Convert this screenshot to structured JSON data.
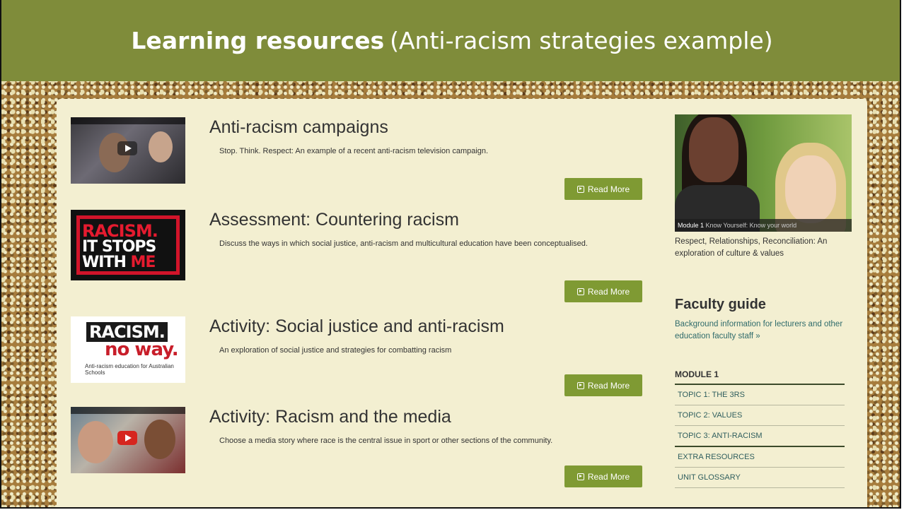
{
  "header": {
    "title_bold": "Learning resources",
    "title_rest": "(Anti-racism strategies example)"
  },
  "articles": [
    {
      "title": "Anti-racism campaigns",
      "description": "Stop. Think. Respect: An example of a recent anti-racism television campaign.",
      "read_more": "Read More",
      "thumbnail": "video-thumbnail"
    },
    {
      "title": "Assessment: Countering racism",
      "description": "Discuss the ways in which social justice, anti-racism and multicultural education have been conceptualised.",
      "read_more": "Read More",
      "thumbnail": {
        "line1": "RACISM.",
        "line2": "IT STOPS",
        "line3a": "WITH ",
        "line3b": "ME"
      }
    },
    {
      "title": "Activity: Social justice and anti-racism",
      "description": "An exploration of social justice and strategies for combatting racism",
      "read_more": "Read More",
      "thumbnail": {
        "line1": "RACISM.",
        "line2": "no way.",
        "line3": "Anti-racism education for Australian Schools"
      }
    },
    {
      "title": "Activity: Racism and the media",
      "description": "Choose a media story where race is the central issue in sport or other sections of the community.",
      "read_more": "Read More",
      "thumbnail": "video-thumbnail"
    }
  ],
  "sidebar": {
    "module_image_caption_a": "Module 1",
    "module_image_caption_b": "Know Yourself: Know your world",
    "module_description": "Respect, Relationships, Reconciliation: An exploration of culture & values",
    "faculty_title": "Faculty guide",
    "faculty_link": "Background information for lecturers and other education faculty staff »",
    "module_heading": "MODULE 1",
    "module_items": [
      "TOPIC 1: THE 3RS",
      "TOPIC 2: VALUES",
      "TOPIC 3: ANTI-RACISM",
      "EXTRA RESOURCES",
      "UNIT GLOSSARY"
    ]
  },
  "colors": {
    "title_bar": "#7f8c3a",
    "read_more_button": "#7f9a33",
    "page_background": "#f3efd1",
    "link": "#2f6b6b"
  }
}
